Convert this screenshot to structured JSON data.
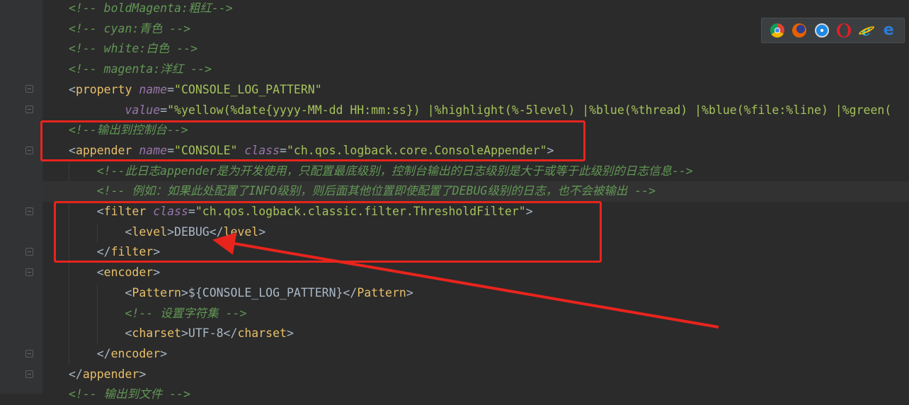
{
  "gutter": {
    "bulb_icon": "lightbulb-icon"
  },
  "lines": [
    [
      {
        "t": "<!-- boldMagenta:粗红-->",
        "c": "c"
      }
    ],
    [
      {
        "t": "<!-- cyan:青色 -->",
        "c": "c"
      }
    ],
    [
      {
        "t": "<!-- white:白色 -->",
        "c": "c"
      }
    ],
    [
      {
        "t": "<!-- magenta:洋红 -->",
        "c": "c"
      }
    ],
    [
      {
        "t": "<",
        "c": "tx"
      },
      {
        "t": "property ",
        "c": "tg"
      },
      {
        "t": "name",
        "c": "an"
      },
      {
        "t": "=",
        "c": "tx"
      },
      {
        "t": "\"CONSOLE_LOG_PATTERN\"",
        "c": "av"
      }
    ],
    [
      {
        "t": "        ",
        "c": "tx"
      },
      {
        "t": "value",
        "c": "an"
      },
      {
        "t": "=",
        "c": "tx"
      },
      {
        "t": "\"%yellow(%date{yyyy-MM-dd HH:mm:ss}) |%highlight(%-5level) |%blue(%thread) |%blue(%file:%line) |%green(",
        "c": "av"
      }
    ],
    [
      {
        "t": "<!--输出到控制台-->",
        "c": "c"
      }
    ],
    [
      {
        "t": "<",
        "c": "tx"
      },
      {
        "t": "appender ",
        "c": "tg"
      },
      {
        "t": "name",
        "c": "an"
      },
      {
        "t": "=",
        "c": "tx"
      },
      {
        "t": "\"CONSOLE\" ",
        "c": "av"
      },
      {
        "t": "class",
        "c": "an"
      },
      {
        "t": "=",
        "c": "tx"
      },
      {
        "t": "\"ch.qos.logback.core.ConsoleAppender\"",
        "c": "av"
      },
      {
        "t": ">",
        "c": "tx"
      }
    ],
    [
      {
        "t": "    <!--此日志appender是为开发使用，只配置最底级别，控制台输出的日志级别是大于或等于此级别的日志信息-->",
        "c": "c"
      }
    ],
    [
      {
        "t": "    <!-- 例如：如果此处配置了INFO级别，则后面其他位置即使配置了DEBUG级别的日志，也不会被输出 -->",
        "c": "c"
      }
    ],
    [
      {
        "t": "    <",
        "c": "tx"
      },
      {
        "t": "filter ",
        "c": "tg"
      },
      {
        "t": "class",
        "c": "an"
      },
      {
        "t": "=",
        "c": "tx"
      },
      {
        "t": "\"ch.qos.logback.classic.filter.ThresholdFilter\"",
        "c": "av"
      },
      {
        "t": ">",
        "c": "tx"
      }
    ],
    [
      {
        "t": "        <",
        "c": "tx"
      },
      {
        "t": "level",
        "c": "tg"
      },
      {
        "t": ">DEBUG</",
        "c": "tx"
      },
      {
        "t": "level",
        "c": "tg"
      },
      {
        "t": ">",
        "c": "tx"
      }
    ],
    [
      {
        "t": "    </",
        "c": "tx"
      },
      {
        "t": "filter",
        "c": "tg"
      },
      {
        "t": ">",
        "c": "tx"
      }
    ],
    [
      {
        "t": "    <",
        "c": "tx"
      },
      {
        "t": "encoder",
        "c": "tg"
      },
      {
        "t": ">",
        "c": "tx"
      }
    ],
    [
      {
        "t": "        <",
        "c": "tx"
      },
      {
        "t": "Pattern",
        "c": "tg"
      },
      {
        "t": ">${CONSOLE_LOG_PATTERN}</",
        "c": "tx"
      },
      {
        "t": "Pattern",
        "c": "tg"
      },
      {
        "t": ">",
        "c": "tx"
      }
    ],
    [
      {
        "t": "        <!-- 设置字符集 -->",
        "c": "c"
      }
    ],
    [
      {
        "t": "        <",
        "c": "tx"
      },
      {
        "t": "charset",
        "c": "tg"
      },
      {
        "t": ">UTF-8</",
        "c": "tx"
      },
      {
        "t": "charset",
        "c": "tg"
      },
      {
        "t": ">",
        "c": "tx"
      }
    ],
    [
      {
        "t": "    </",
        "c": "tx"
      },
      {
        "t": "encoder",
        "c": "tg"
      },
      {
        "t": ">",
        "c": "tx"
      }
    ],
    [
      {
        "t": "</",
        "c": "tx"
      },
      {
        "t": "appender",
        "c": "tg"
      },
      {
        "t": ">",
        "c": "tx"
      }
    ],
    [
      {
        "t": "<!-- 输出到文件 -->",
        "c": "c"
      }
    ]
  ],
  "current_line_index": 9,
  "browser_icons": [
    "chrome-icon",
    "firefox-icon",
    "safari-icon",
    "opera-icon",
    "ie-icon",
    "edge-icon"
  ],
  "annotation_color": "#e8241d"
}
